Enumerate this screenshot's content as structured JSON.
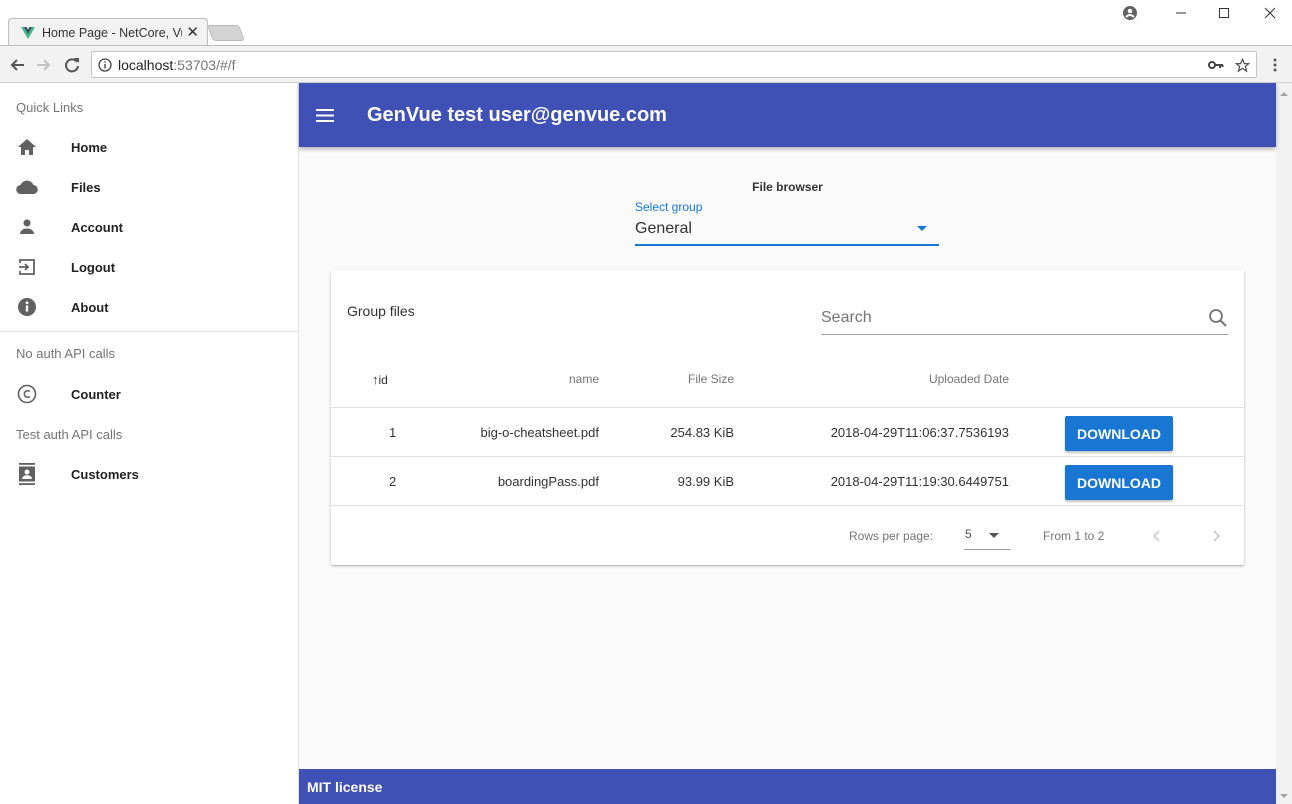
{
  "browser": {
    "tab_title": "Home Page - NetCore, Vue",
    "url_host": "localhost",
    "url_rest": ":53703/#/f"
  },
  "sidebar": {
    "sections": [
      {
        "header": "Quick Links",
        "items": [
          {
            "label": "Home",
            "icon": "home-icon"
          },
          {
            "label": "Files",
            "icon": "cloud-icon"
          },
          {
            "label": "Account",
            "icon": "person-icon"
          },
          {
            "label": "Logout",
            "icon": "logout-icon"
          },
          {
            "label": "About",
            "icon": "info-icon"
          }
        ]
      },
      {
        "header": "No auth API calls",
        "items": [
          {
            "label": "Counter",
            "icon": "copyright-icon"
          }
        ]
      },
      {
        "header": "Test auth API calls",
        "items": [
          {
            "label": "Customers",
            "icon": "contacts-icon"
          }
        ]
      }
    ]
  },
  "appbar": {
    "title": "GenVue test user@genvue.com",
    "color": "#3f51b5"
  },
  "main": {
    "heading": "File browser",
    "group_select": {
      "label": "Select group",
      "value": "General"
    },
    "card": {
      "title": "Group files",
      "search_placeholder": "Search",
      "columns": [
        {
          "label": "id",
          "sorted": "ascending"
        },
        {
          "label": "name"
        },
        {
          "label": "File Size"
        },
        {
          "label": "Uploaded Date"
        }
      ],
      "rows": [
        {
          "id": "1",
          "name": "big-o-cheatsheet.pdf",
          "size": "254.83 KiB",
          "date": "2018-04-29T11:06:37.7536193",
          "action": "DOWNLOAD"
        },
        {
          "id": "2",
          "name": "boardingPass.pdf",
          "size": "93.99 KiB",
          "date": "2018-04-29T11:19:30.6449751",
          "action": "DOWNLOAD"
        }
      ],
      "pagination": {
        "rows_per_page_label": "Rows per page:",
        "rows_per_page": "5",
        "range": "From 1 to 2"
      }
    }
  },
  "footer": {
    "text": "MIT license"
  },
  "colors": {
    "primary": "#3f51b5",
    "accent": "#1976d2"
  }
}
